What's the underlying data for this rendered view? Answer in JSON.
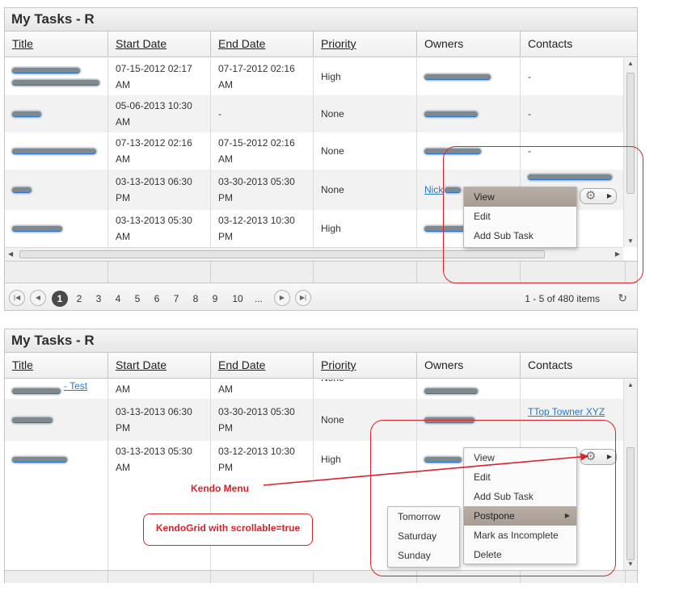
{
  "grid_title": "My Tasks - R",
  "columns": {
    "title": "Title",
    "start_date": "Start Date",
    "end_date": "End Date",
    "priority": "Priority",
    "owners": "Owners",
    "contacts": "Contacts"
  },
  "grid1": {
    "rows": [
      {
        "start1": "07-15-2012 02:17",
        "start2": "AM",
        "end1": "07-17-2012 02:16",
        "end2": "AM",
        "priority": "High",
        "contacts": "-"
      },
      {
        "start1": "05-06-2013 10:30",
        "start2": "AM",
        "end1": "-",
        "end2": "",
        "priority": "None",
        "contacts": "-"
      },
      {
        "start1": "07-13-2012 02:16",
        "start2": "AM",
        "end1": "07-15-2012 02:16",
        "end2": "AM",
        "priority": "None",
        "contacts": "-"
      },
      {
        "start1": "03-13-2013 06:30",
        "start2": "PM",
        "end1": "03-30-2013 05:30",
        "end2": "PM",
        "priority": "None",
        "contacts": ""
      },
      {
        "start1": "03-13-2013 05:30",
        "start2": "AM",
        "end1": "03-12-2013 10:30",
        "end2": "PM",
        "priority": "High",
        "contacts": ""
      }
    ],
    "owner_partial": "Nick",
    "menu": [
      "View",
      "Edit",
      "Add Sub Task"
    ],
    "pager": {
      "pages": [
        "1",
        "2",
        "3",
        "4",
        "5",
        "6",
        "7",
        "8",
        "9",
        "10",
        "..."
      ],
      "current": "1",
      "info": "1 - 5 of 480 items"
    }
  },
  "grid2": {
    "rows": [
      {
        "start1": "",
        "start2": "AM",
        "end1": "",
        "end2": "AM",
        "priority": "None",
        "title_suffix": "- Test"
      },
      {
        "start1": "03-13-2013 06:30",
        "start2": "PM",
        "end1": "03-30-2013 05:30",
        "end2": "PM",
        "priority": "None",
        "contacts_partial": "TTop Towner XYZ"
      },
      {
        "start1": "03-13-2013 05:30",
        "start2": "AM",
        "end1": "03-12-2013 10:30",
        "end2": "PM",
        "priority": "High"
      }
    ],
    "menu": [
      "View",
      "Edit",
      "Add Sub Task",
      "Postpone",
      "Mark as Incomplete",
      "Delete"
    ],
    "submenu": [
      "Tomorrow",
      "Saturday",
      "Sunday"
    ]
  },
  "annotations": {
    "kendo_menu": "Kendo Menu",
    "kendo_grid": "KendoGrid with scrollable=true"
  },
  "colors": {
    "annotation_red": "#d9222a",
    "link_blue": "#2a76c6",
    "menu_highlight": "#b1a69d"
  },
  "icons": {
    "settings": "gear-icon",
    "refresh": "refresh-icon"
  }
}
